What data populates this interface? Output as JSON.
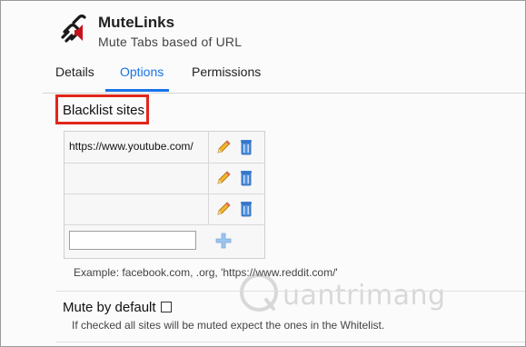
{
  "app": {
    "name": "MuteLinks",
    "description": "Mute Tabs based of URL"
  },
  "tabs": [
    {
      "label": "Details",
      "active": false
    },
    {
      "label": "Options",
      "active": true
    },
    {
      "label": "Permissions",
      "active": false
    }
  ],
  "blacklist": {
    "title": "Blacklist sites",
    "rows": [
      {
        "url": "https://www.youtube.com/"
      },
      {
        "url": ""
      },
      {
        "url": ""
      }
    ],
    "new_entry_value": "",
    "example": "Example: facebook.com, .org, 'https://www.reddit.com/'"
  },
  "mute_default": {
    "label": "Mute by default",
    "checked": false,
    "help": "If checked all sites will be muted expect the ones in the Whitelist."
  },
  "watermark": {
    "text": "uantrimang"
  },
  "colors": {
    "accent": "#1a73e8",
    "highlight_box": "#e1261c"
  }
}
